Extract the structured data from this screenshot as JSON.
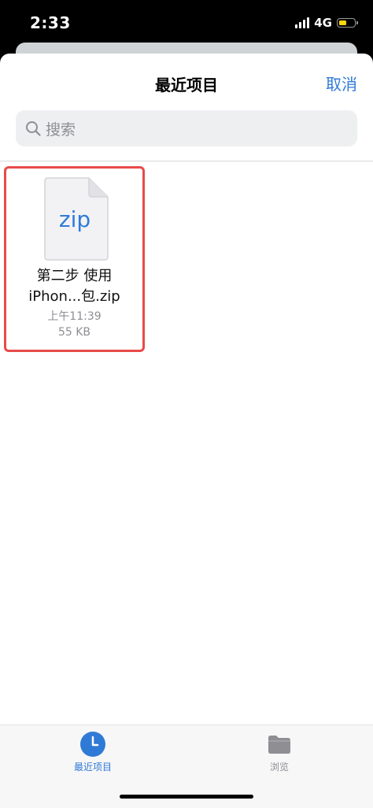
{
  "status_bar": {
    "time": "2:33",
    "network": "4G",
    "battery_color": "#ffd60a"
  },
  "header": {
    "title": "最近项目",
    "cancel_label": "取消"
  },
  "search": {
    "placeholder": "搜索"
  },
  "files": [
    {
      "icon": "zip-file-icon",
      "icon_text": "zip",
      "name_line1": "第二步 使用",
      "name_line2": "iPhon...包.zip",
      "time": "上午11:39",
      "size": "55 KB"
    }
  ],
  "tab_bar": {
    "tabs": [
      {
        "label": "最近项目",
        "icon": "clock-icon",
        "selected": true
      },
      {
        "label": "浏览",
        "icon": "folder-icon",
        "selected": false
      }
    ]
  },
  "colors": {
    "accent": "#2f7ad6",
    "highlight_border": "#e84a4a"
  }
}
